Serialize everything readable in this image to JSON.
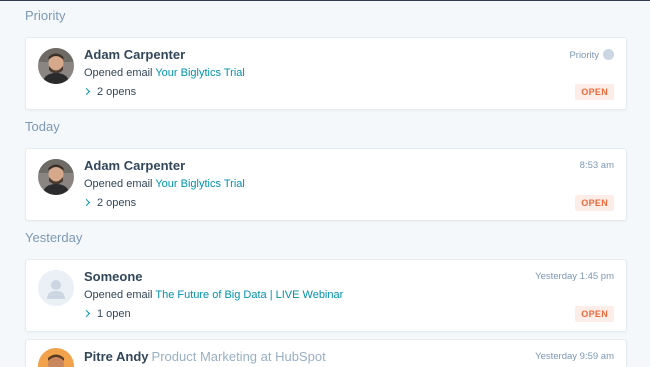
{
  "sections": {
    "priority": "Priority",
    "today": "Today",
    "yesterday": "Yesterday"
  },
  "items": [
    {
      "name": "Adam Carpenter",
      "action": "Opened email",
      "link": "Your Biglytics Trial",
      "opens": "2 opens",
      "time": "Priority",
      "badge": "OPEN"
    },
    {
      "name": "Adam Carpenter",
      "action": "Opened email",
      "link": "Your Biglytics Trial",
      "opens": "2 opens",
      "time": "8:53 am",
      "badge": "OPEN"
    },
    {
      "name": "Someone",
      "action": "Opened email",
      "link": "The Future of Big Data | LIVE Webinar",
      "opens": "1 open",
      "time": "Yesterday 1:45 pm",
      "badge": "OPEN"
    },
    {
      "name": "Pitre Andy",
      "subtitle": "Product Marketing at HubSpot",
      "time": "Yesterday 9:59 am"
    }
  ],
  "colors": {
    "background": "#f5f8fa",
    "link": "#0091ae",
    "badge_text": "#ea6a3c",
    "badge_bg": "#fdede8"
  }
}
